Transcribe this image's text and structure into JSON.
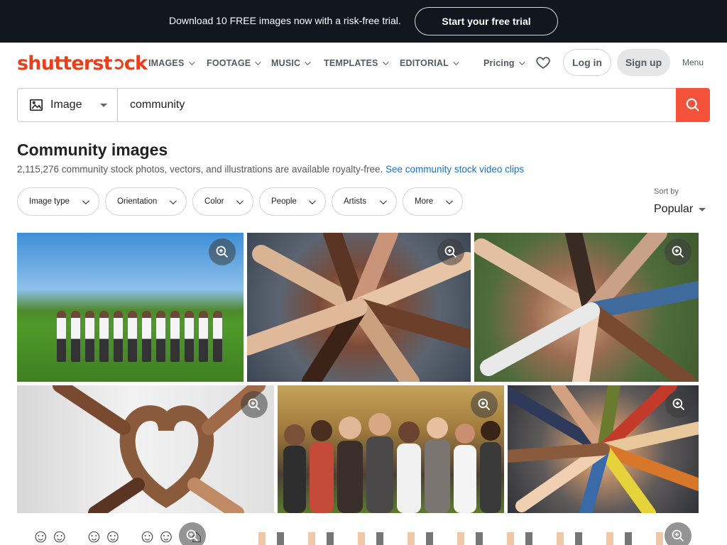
{
  "promo": {
    "text": "Download 10 FREE images now with a risk-free trial.",
    "cta": "Start your free trial"
  },
  "header": {
    "logo_a": "shutterst",
    "logo_b": "ck",
    "nav": [
      {
        "label": "IMAGES"
      },
      {
        "label": "FOOTAGE"
      },
      {
        "label": "MUSIC"
      },
      {
        "label": "TEMPLATES"
      },
      {
        "label": "EDITORIAL"
      }
    ],
    "pricing": "Pricing",
    "login": "Log in",
    "signup": "Sign up",
    "menu": "Menu"
  },
  "search": {
    "type": "Image",
    "query": "community"
  },
  "results": {
    "title": "Community images",
    "summary": "2,115,276 community stock photos, vectors, and illustrations are available royalty-free.",
    "video_link": "See community stock video clips"
  },
  "filters": [
    {
      "label": "Image type"
    },
    {
      "label": "Orientation"
    },
    {
      "label": "Color"
    },
    {
      "label": "People"
    },
    {
      "label": "Artists"
    },
    {
      "label": "More"
    }
  ],
  "sort": {
    "label": "Sort by",
    "value": "Popular"
  },
  "colors": {
    "brand": "#e8401c",
    "search_button": "#f5523c",
    "link": "#1a73c9",
    "banner_bg": "#10171f"
  },
  "icons": {
    "search": "magnifier-icon",
    "zoom": "zoom-in-icon",
    "favorites": "heart-icon",
    "image_type": "image-icon"
  }
}
